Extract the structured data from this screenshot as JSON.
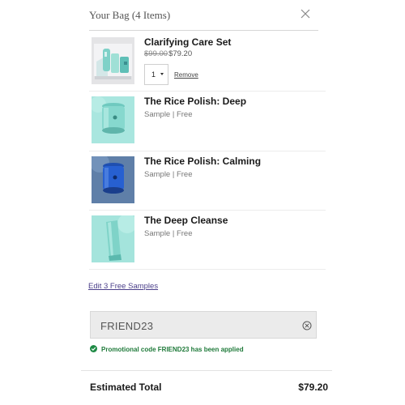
{
  "header": {
    "title": "Your Bag (4 Items)",
    "close_icon": "close-icon"
  },
  "items": [
    {
      "name": "Clarifying Care Set",
      "original_price": "$99.00",
      "price": "$79.20",
      "quantity": "1",
      "remove_label": "Remove",
      "thumb_icon": "product-image-care-set"
    },
    {
      "name": "The Rice Polish: Deep",
      "subtitle": "Sample | Free",
      "thumb_icon": "product-image-rice-polish-deep"
    },
    {
      "name": "The Rice Polish: Calming",
      "subtitle": "Sample | Free",
      "thumb_icon": "product-image-rice-polish-calming"
    },
    {
      "name": "The Deep Cleanse",
      "subtitle": "Sample | Free",
      "thumb_icon": "product-image-deep-cleanse"
    }
  ],
  "samples": {
    "edit_label": "Edit 3 Free Samples"
  },
  "promo": {
    "value": "FRIEND23",
    "clear_icon": "clear-circle-icon",
    "message": "Promotional code FRIEND23 has been applied",
    "message_icon": "check-circle-icon",
    "success_color": "#1e8a45"
  },
  "totals": {
    "label": "Estimated Total",
    "value": "$79.20"
  },
  "colors": {
    "link": "#4b3f8a",
    "text": "#1a1a1a"
  }
}
